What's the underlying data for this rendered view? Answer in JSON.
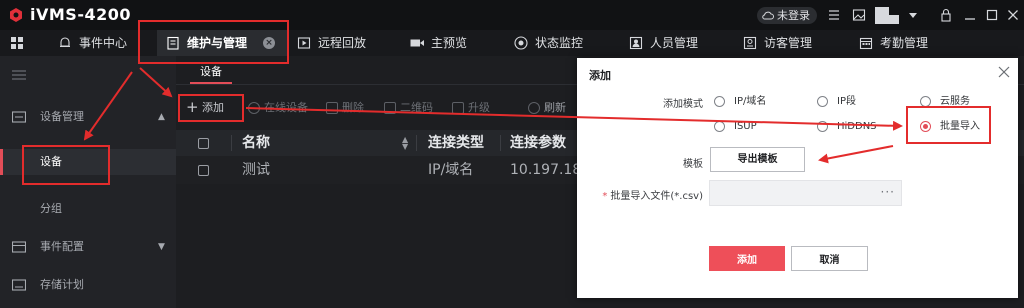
{
  "app": {
    "title": "iVMS-4200"
  },
  "titlebar": {
    "login_status": "未登录",
    "icons": [
      "list-icon",
      "image-icon",
      "avatar",
      "chevron-down-icon",
      "lock-icon",
      "minimize-icon",
      "maximize-icon",
      "close-icon"
    ]
  },
  "tabs": [
    {
      "label": "事件中心",
      "icon": "bell-icon"
    },
    {
      "label": "维护与管理",
      "icon": "clipboard-icon",
      "active": true
    },
    {
      "label": "远程回放",
      "icon": "playback-icon"
    },
    {
      "label": "主预览",
      "icon": "camera-icon"
    },
    {
      "label": "状态监控",
      "icon": "monitor-icon"
    },
    {
      "label": "人员管理",
      "icon": "person-card-icon"
    },
    {
      "label": "访客管理",
      "icon": "visitor-icon"
    },
    {
      "label": "考勤管理",
      "icon": "calendar-icon"
    }
  ],
  "sidebar": {
    "items": [
      {
        "label": "设备管理",
        "expanded": true
      },
      {
        "label": "设备",
        "selected": true
      },
      {
        "label": "分组"
      },
      {
        "label": "事件配置",
        "expanded": false
      },
      {
        "label": "存储计划"
      }
    ]
  },
  "main": {
    "subtab": "设备",
    "toolbar": {
      "add": "添加",
      "online": "在线设备",
      "delete": "删除",
      "qr": "二维码",
      "upgrade": "升级",
      "refresh": "刷新"
    },
    "table": {
      "columns": [
        "名称",
        "连接类型",
        "连接参数"
      ],
      "rows": [
        {
          "name": "测试",
          "type": "IP/域名",
          "param": "10.197.18"
        }
      ]
    }
  },
  "modal": {
    "title": "添加",
    "mode_label": "添加模式",
    "modes": [
      "IP/域名",
      "IP段",
      "云服务",
      "ISUP",
      "HiDDNS",
      "批量导入"
    ],
    "selected_mode": "批量导入",
    "template_label": "模板",
    "export_button": "导出模板",
    "file_label": "批量导入文件(*.csv)",
    "file_value": "",
    "file_browse": "···",
    "ok_button": "添加",
    "cancel_button": "取消"
  },
  "colors": {
    "accent": "#e24d58",
    "annotation": "#e32c2c",
    "dark_bg": "#1b1c1f"
  }
}
